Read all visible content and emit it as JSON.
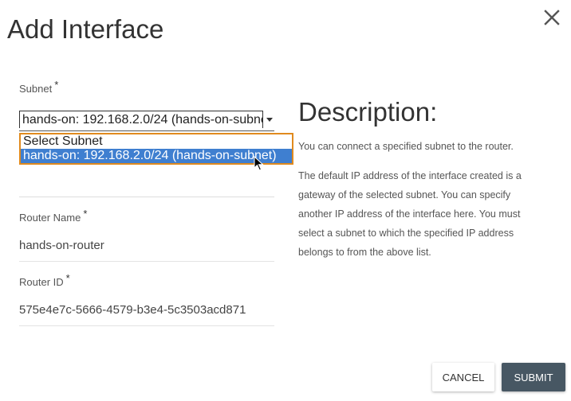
{
  "dialog": {
    "title": "Add Interface",
    "close_icon": "close-icon"
  },
  "subnet": {
    "label": "Subnet",
    "required_mark": "*",
    "selected_value": "hands-on: 192.168.2.0/24 (hands-on-subnet)",
    "options": [
      "Select Subnet",
      "hands-on: 192.168.2.0/24 (hands-on-subnet)"
    ],
    "highlighted_option_index": 1
  },
  "router_name": {
    "label": "Router Name",
    "required_mark": "*",
    "value": "hands-on-router"
  },
  "router_id": {
    "label": "Router ID",
    "required_mark": "*",
    "value": "575e4e7c-5666-4579-b3e4-5c3503acd871"
  },
  "description": {
    "title": "Description:",
    "paragraph_1": "You can connect a specified subnet to the router.",
    "paragraph_2": "The default IP address of the interface created is a gateway of the selected subnet. You can specify another IP address of the interface here. You must select a subnet to which the specified IP address belongs to from the above list."
  },
  "buttons": {
    "cancel_label": "Cancel",
    "submit_label": "Submit"
  },
  "colors": {
    "dropdown_border": "#e08a1e",
    "option_highlight": "#3f7fd0",
    "submit_bg": "#475763"
  }
}
